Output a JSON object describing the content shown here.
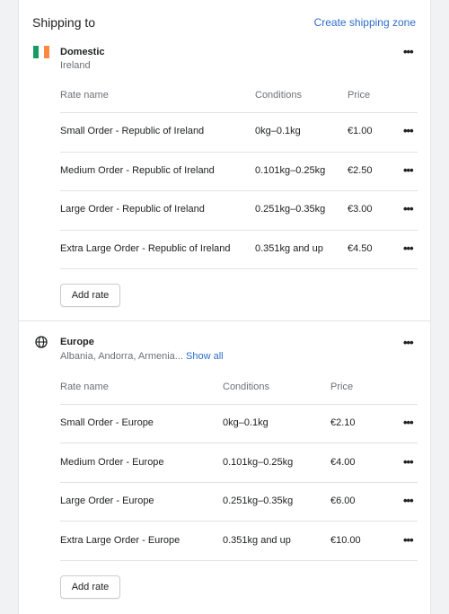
{
  "header": {
    "title": "Shipping to",
    "action_label": "Create shipping zone"
  },
  "zones": [
    {
      "name": "Domestic",
      "subtitle": "Ireland",
      "icon": "ireland-flag-icon",
      "flag_colors": [
        "#169b62",
        "#ffffff",
        "#ff883e"
      ],
      "columns": [
        "Rate name",
        "Conditions",
        "Price"
      ],
      "rates": [
        {
          "name": "Small Order - Republic of Ireland",
          "conditions": "0kg–0.1kg",
          "price": "€1.00"
        },
        {
          "name": "Medium Order - Republic of Ireland",
          "conditions": "0.101kg–0.25kg",
          "price": "€2.50"
        },
        {
          "name": "Large Order - Republic of Ireland",
          "conditions": "0.251kg–0.35kg",
          "price": "€3.00"
        },
        {
          "name": "Extra Large Order - Republic of Ireland",
          "conditions": "0.351kg and up",
          "price": "€4.50"
        }
      ],
      "add_rate_label": "Add rate",
      "more_label": "•••"
    },
    {
      "name": "Europe",
      "subtitle": "Albania, Andorra, Armenia...",
      "show_all_label": "Show all",
      "icon": "globe-icon",
      "columns": [
        "Rate name",
        "Conditions",
        "Price"
      ],
      "rates": [
        {
          "name": "Small Order - Europe",
          "conditions": "0kg–0.1kg",
          "price": "€2.10"
        },
        {
          "name": "Medium Order - Europe",
          "conditions": "0.101kg–0.25kg",
          "price": "€4.00"
        },
        {
          "name": "Large Order - Europe",
          "conditions": "0.251kg–0.35kg",
          "price": "€6.00"
        },
        {
          "name": "Extra Large Order - Europe",
          "conditions": "0.351kg and up",
          "price": "€10.00"
        }
      ],
      "add_rate_label": "Add rate",
      "more_label": "•••"
    }
  ],
  "colors": {
    "link": "#2c6ecb",
    "subdued_text": "#6d7175",
    "divider": "#e1e3e5"
  }
}
